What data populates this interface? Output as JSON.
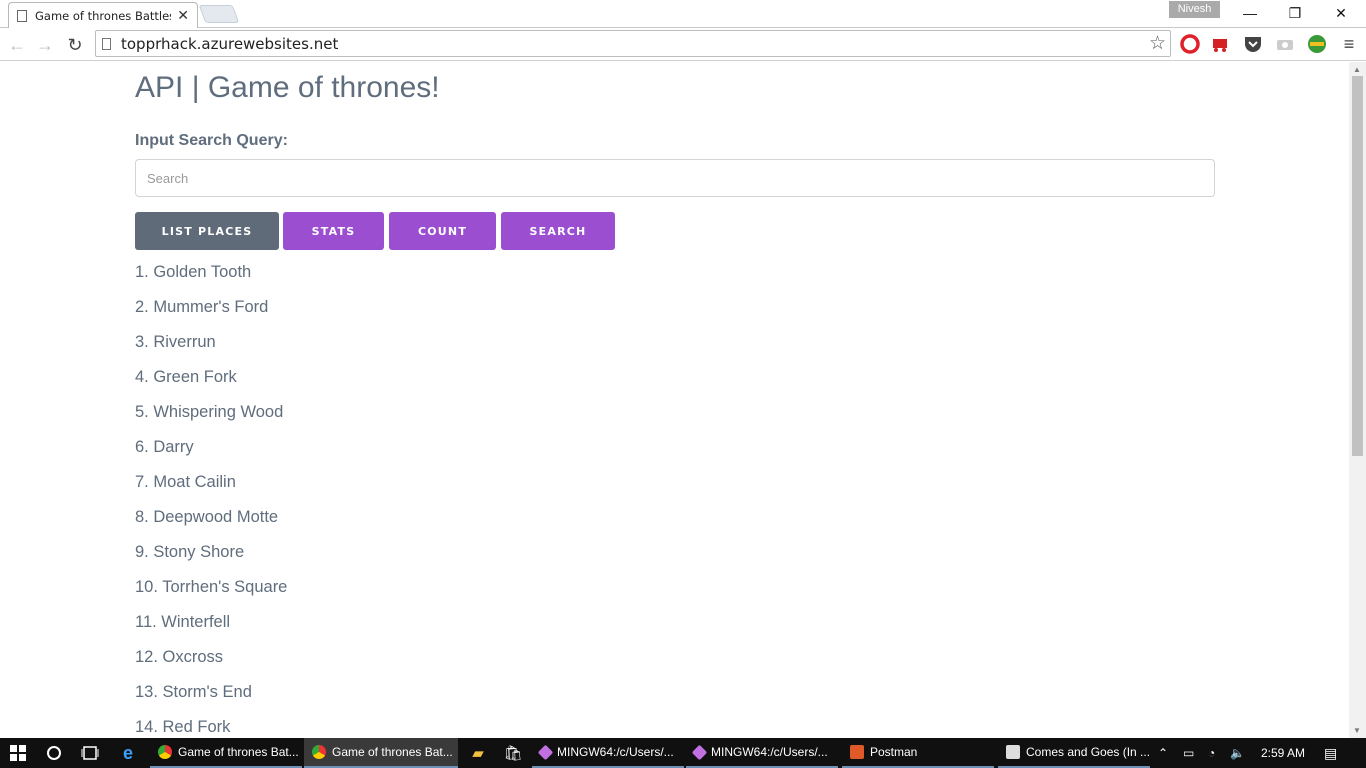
{
  "browser": {
    "tab_title": "Game of thrones Battles, A",
    "profile_name": "Nivesh",
    "url": "topprhack.azurewebsites.net"
  },
  "page": {
    "title": "API | Game of thrones!",
    "query_label": "Input Search Query:",
    "search_placeholder": "Search",
    "buttons": {
      "list_places": "LIST PLACES",
      "stats": "STATS",
      "count": "COUNT",
      "search": "SEARCH"
    },
    "places": [
      "1. Golden Tooth",
      "2. Mummer's Ford",
      "3. Riverrun",
      "4. Green Fork",
      "5. Whispering Wood",
      "6. Darry",
      "7. Moat Cailin",
      "8. Deepwood Motte",
      "9. Stony Shore",
      "10. Torrhen's Square",
      "11. Winterfell",
      "12. Oxcross",
      "13. Storm's End",
      "14. Red Fork"
    ]
  },
  "taskbar": {
    "apps": [
      "Game of thrones Bat...",
      "Game of thrones Bat...",
      "MINGW64:/c/Users/...",
      "MINGW64:/c/Users/...",
      "Postman",
      "Comes and Goes (In ..."
    ],
    "clock": "2:59 AM"
  },
  "colors": {
    "text": "#5f6d7d",
    "button_dark": "#5f6b78",
    "button_accent": "#9b4fd0"
  }
}
